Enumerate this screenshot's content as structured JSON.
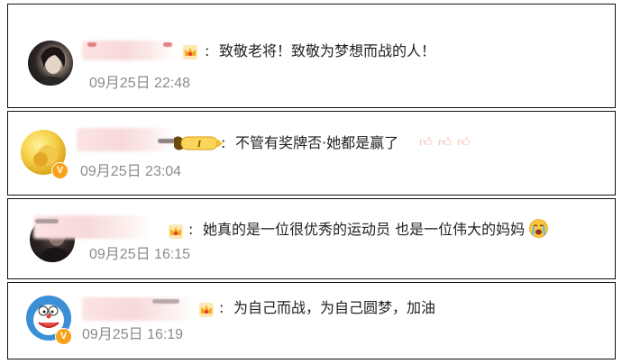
{
  "comments": [
    {
      "text": "致敬老将！致敬为梦想而战的人！",
      "time": "09月25日 22:48"
    },
    {
      "text": "不管有奖牌否·她都是赢了",
      "time": "09月25日 23:04"
    },
    {
      "text": "她真的是一位很优秀的运动员 也是一位伟大的妈妈",
      "time": "09月25日 16:15"
    },
    {
      "text": "为自己而战，为自己圆梦，加油",
      "time": "09月25日 16:19"
    }
  ],
  "separator": ":",
  "level_badge_text": "I",
  "colors": {
    "time": "#8b8b8b",
    "text": "#222222",
    "border": "#111111",
    "verified_badge": "#f7a21b",
    "crown": "#f5b21f"
  },
  "icons": {
    "crown": "crown-icon",
    "verified": "verified-v-icon",
    "thumb": "thumbs-up-icon",
    "cry": "crying-face-icon",
    "level": "level-badge-icon"
  }
}
